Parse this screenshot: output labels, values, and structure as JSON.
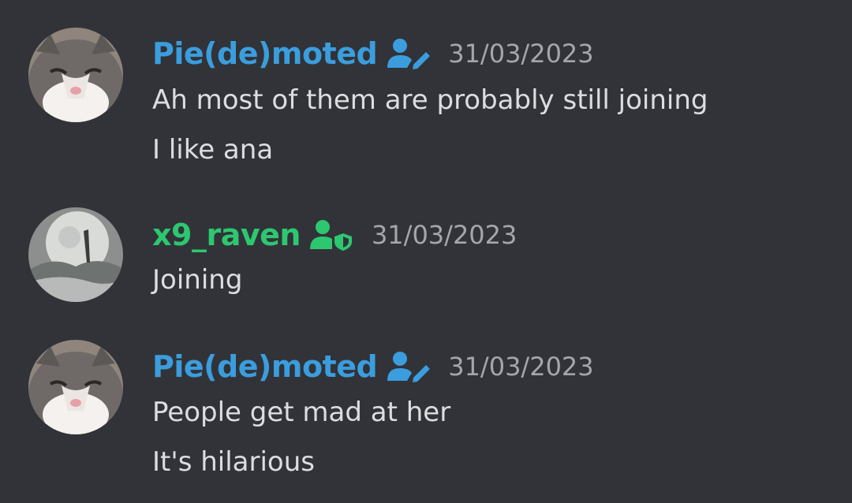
{
  "messages": [
    {
      "author": "Pie(de)moted",
      "author_color": "#3b9ddd",
      "role_icon": "user-pencil-icon",
      "timestamp": "31/03/2023",
      "lines": [
        "Ah most of them are probably still joining",
        "I like ana"
      ]
    },
    {
      "author": "x9_raven",
      "author_color": "#2dc770",
      "role_icon": "user-shield-icon",
      "timestamp": "31/03/2023",
      "lines": [
        "Joining"
      ]
    },
    {
      "author": "Pie(de)moted",
      "author_color": "#3b9ddd",
      "role_icon": "user-pencil-icon",
      "timestamp": "31/03/2023",
      "lines": [
        "People get mad at her",
        "It's hilarious"
      ]
    }
  ],
  "colors": {
    "background": "#313338",
    "message_text": "#dbdee1",
    "timestamp": "#a4a6ab"
  }
}
